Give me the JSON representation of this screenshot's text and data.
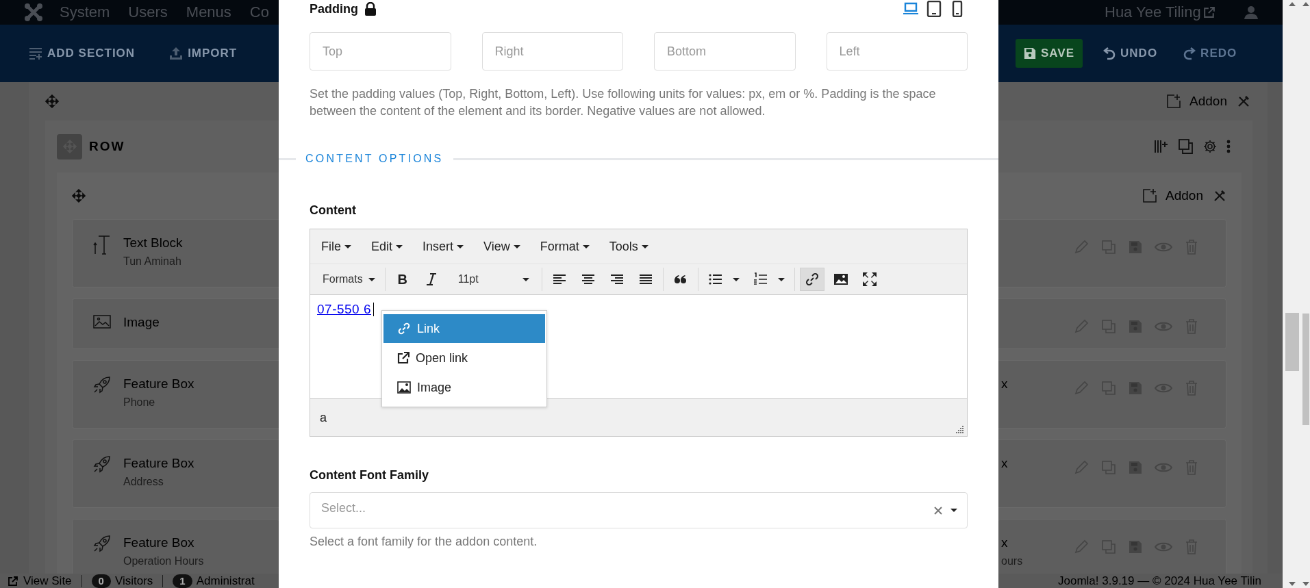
{
  "topbar": {
    "menu": [
      "System",
      "Users",
      "Menus",
      "Co"
    ],
    "site_link": "Hua Yee Tiling"
  },
  "toolbar": {
    "left": [
      {
        "kind": "add-section",
        "label": "ADD SECTION"
      },
      {
        "kind": "import",
        "label": "IMPORT"
      }
    ],
    "right": [
      {
        "kind": "save",
        "label": "SAVE",
        "disabled": false
      },
      {
        "kind": "undo",
        "label": "UNDO",
        "disabled": false
      },
      {
        "kind": "redo",
        "label": "REDO",
        "disabled": true
      }
    ]
  },
  "builder": {
    "section_addon": "Addon",
    "row_label": "ROW",
    "column_addon": "Addon",
    "addons": [
      {
        "kind": "text",
        "title": "Text Block",
        "subtitle": "Tun Aminah"
      },
      {
        "kind": "image",
        "title": "Image"
      },
      {
        "kind": "feature",
        "title": "Feature Box",
        "subtitle": "Phone",
        "right_title": "x"
      },
      {
        "kind": "feature",
        "title": "Feature Box",
        "subtitle": "Address",
        "right_title": "x"
      },
      {
        "kind": "feature",
        "title": "Feature Box",
        "subtitle": "Operation Hours",
        "right_title": "x",
        "right_subtitle": "ours"
      }
    ]
  },
  "footer": {
    "left": [
      {
        "kind": "link",
        "label": "View Site"
      },
      {
        "kind": "count",
        "count": "0",
        "label": "Visitors"
      },
      {
        "kind": "count",
        "count": "1",
        "label": "Administrat"
      }
    ],
    "right": "Joomla! 3.9.19 — © 2024 Hua Yee Tilin"
  },
  "modal": {
    "padding": {
      "label": "Padding",
      "devices": [
        {
          "kind": "desktop",
          "selected": true
        },
        {
          "kind": "tablet",
          "selected": false
        },
        {
          "kind": "mobile",
          "selected": false
        }
      ],
      "fields": [
        {
          "placeholder": "Top"
        },
        {
          "placeholder": "Right"
        },
        {
          "placeholder": "Bottom"
        },
        {
          "placeholder": "Left"
        }
      ],
      "help": "Set the padding values (Top, Right, Bottom, Left). Use following units for values: px, em or %. Padding is the space between the content of the element and its border. Negative values are not allowed."
    },
    "section_title": "CONTENT OPTIONS",
    "content": {
      "label": "Content",
      "menu": [
        "File",
        "Edit",
        "Insert",
        "View",
        "Format",
        "Tools"
      ],
      "toolbar": [
        [
          {
            "kind": "formats",
            "label": "Formats",
            "active": false
          }
        ],
        [
          {
            "kind": "bold",
            "label": "B",
            "active": false
          },
          {
            "kind": "italic",
            "active": false
          },
          {
            "kind": "fontsize",
            "label": "11pt",
            "active": false
          }
        ],
        [
          {
            "kind": "align-left",
            "active": false
          },
          {
            "kind": "align-center",
            "active": false
          },
          {
            "kind": "align-right",
            "active": false
          },
          {
            "kind": "justify",
            "active": false
          }
        ],
        [
          {
            "kind": "quote",
            "active": false
          }
        ],
        [
          {
            "kind": "bullet-list",
            "active": false
          },
          {
            "kind": "numbered-list",
            "active": false
          }
        ],
        [
          {
            "kind": "link",
            "active": true
          },
          {
            "kind": "image",
            "active": false
          },
          {
            "kind": "fullscreen",
            "active": false
          }
        ]
      ],
      "body_link": "07-550 6",
      "context_menu": [
        {
          "kind": "link",
          "label": "Link",
          "selected": true
        },
        {
          "kind": "open",
          "label": "Open link",
          "selected": false
        },
        {
          "kind": "image",
          "label": "Image",
          "selected": false
        }
      ],
      "path": "a"
    },
    "font_family": {
      "label": "Content Font Family",
      "placeholder": "Select...",
      "help": "Select a font family for the addon content."
    }
  }
}
